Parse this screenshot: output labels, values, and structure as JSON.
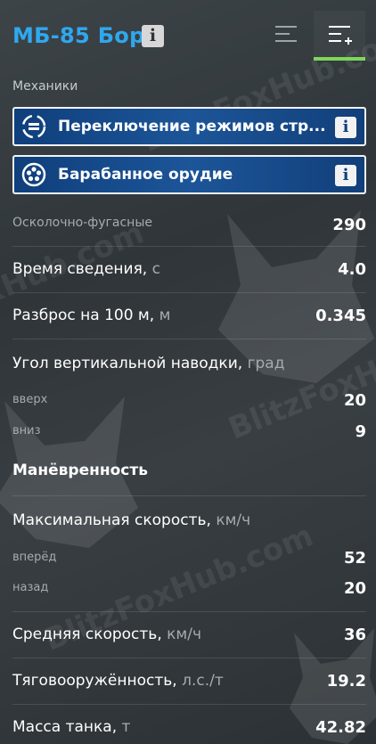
{
  "header": {
    "title": "МБ-85 Бор",
    "info_glyph": "i",
    "menu_left_icon": "list-icon",
    "menu_right_icon": "list-add-icon",
    "accent_color": "#7ed75a",
    "title_color": "#2fa8ef"
  },
  "mechanics": {
    "label": "Механики",
    "modules": [
      {
        "label": "Переключение режимов стр...",
        "icon": "mode-switch-icon",
        "info": "i"
      },
      {
        "label": "Барабанное орудие",
        "icon": "drum-gun-icon",
        "info": "i"
      }
    ]
  },
  "firepower": {
    "rows": [
      {
        "label": "Осколочно-фугасные",
        "unit": "",
        "value": "290"
      },
      {
        "label": "Время сведения,",
        "unit": "с",
        "value": "4.0"
      },
      {
        "label": "Разброс на 100 м,",
        "unit": "м",
        "value": "0.345"
      },
      {
        "label": "Угол вертикальной наводки,",
        "unit": "град",
        "value": ""
      },
      {
        "label": "вверх",
        "unit": "",
        "value": "20"
      },
      {
        "label": "вниз",
        "unit": "",
        "value": "9"
      }
    ]
  },
  "mobility": {
    "heading": "Манёвренность",
    "rows": [
      {
        "label": "Максимальная скорость,",
        "unit": "км/ч",
        "value": ""
      },
      {
        "label": "вперёд",
        "unit": "",
        "value": "52"
      },
      {
        "label": "назад",
        "unit": "",
        "value": "20"
      },
      {
        "label": "Средняя скорость,",
        "unit": "км/ч",
        "value": "36"
      },
      {
        "label": "Тяговооружённость,",
        "unit": "л.с./т",
        "value": "19.2"
      },
      {
        "label": "Масса танка,",
        "unit": "т",
        "value": "42.82"
      }
    ]
  },
  "watermarks": [
    "BlitzFoxHub.com",
    "BlitzFoxHub",
    "BlitzFoxHub.com",
    "BlitzFoxHub.com"
  ]
}
